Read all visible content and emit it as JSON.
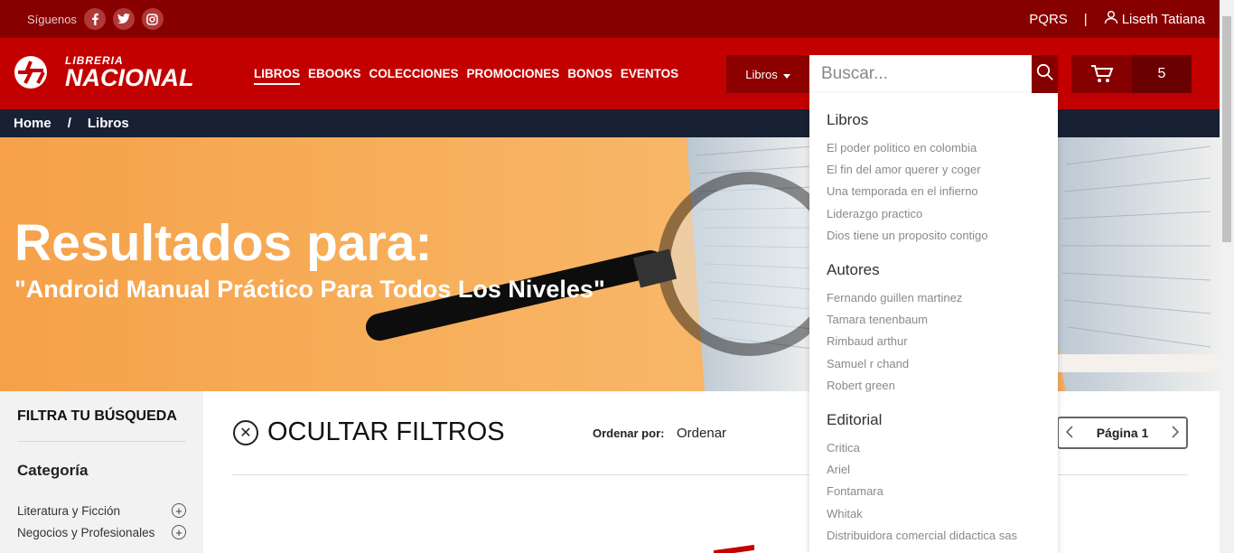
{
  "topbar": {
    "follow_label": "Síguenos",
    "social": [
      "facebook-icon",
      "twitter-icon",
      "instagram-icon"
    ],
    "pqrs": "PQRS",
    "separator": "|",
    "user_name": "Liseth Tatiana"
  },
  "header": {
    "logo_line1": "LIBRERIA",
    "logo_line2": "NACIONAL",
    "nav": [
      "LIBROS",
      "EBOOKS",
      "COLECCIONES",
      "PROMOCIONES",
      "BONOS",
      "EVENTOS"
    ],
    "search": {
      "category": "Libros",
      "placeholder": "Buscar..."
    },
    "cart_count": "5"
  },
  "breadcrumb": {
    "home": "Home",
    "separator": "/",
    "current": "Libros"
  },
  "banner": {
    "title": "Resultados para:",
    "query": "\"Android Manual Práctico Para Todos Los Niveles\""
  },
  "sidebar": {
    "title": "FILTRA TU BÚSQUEDA",
    "category_heading": "Categoría",
    "categories": [
      "Literatura y Ficción",
      "Negocios y Profesionales"
    ]
  },
  "main": {
    "hide_filters": "OCULTAR FILTROS",
    "sort_label": "Ordenar por:",
    "sort_value": "Ordenar",
    "page_label": "Página 1"
  },
  "dropdown": {
    "libros_heading": "Libros",
    "libros": [
      "El poder politico en colombia",
      "El fin del amor querer y coger",
      "Una temporada en el infierno",
      "Liderazgo practico",
      "Dios tiene un proposito contigo"
    ],
    "autores_heading": "Autores",
    "autores": [
      "Fernando guillen martinez",
      "Tamara tenenbaum",
      "Rimbaud arthur",
      "Samuel r chand",
      "Robert green"
    ],
    "editorial_heading": "Editorial",
    "editorial": [
      "Critica",
      "Ariel",
      "Fontamara",
      "Whitak",
      "Distribuidora comercial didactica sas"
    ]
  },
  "colors": {
    "topbar": "#870000",
    "header": "#c30000",
    "breadcrumb": "#182033",
    "banner": "#f7ad58"
  }
}
